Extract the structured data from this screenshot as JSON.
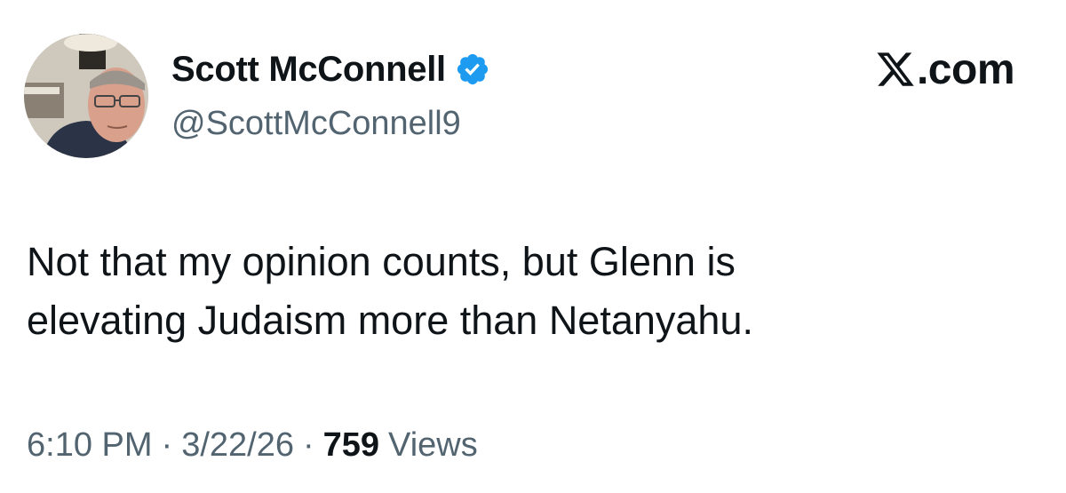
{
  "author": {
    "display_name": "Scott McConnell",
    "handle": "@ScottMcConnell9",
    "verified": true
  },
  "brand": {
    "label": ".com",
    "icon": "x-logo-icon"
  },
  "tweet": {
    "text_lines": [
      "Not that my opinion counts, but Glenn is",
      "elevating Judaism more than Netanyahu."
    ]
  },
  "meta": {
    "time": "6:10 PM",
    "date": "3/22/26",
    "separator": "·",
    "views_count": "759",
    "views_label": "Views"
  },
  "colors": {
    "verified": "#1d9bf0",
    "text_primary": "#0f1419",
    "text_secondary": "#536471"
  }
}
